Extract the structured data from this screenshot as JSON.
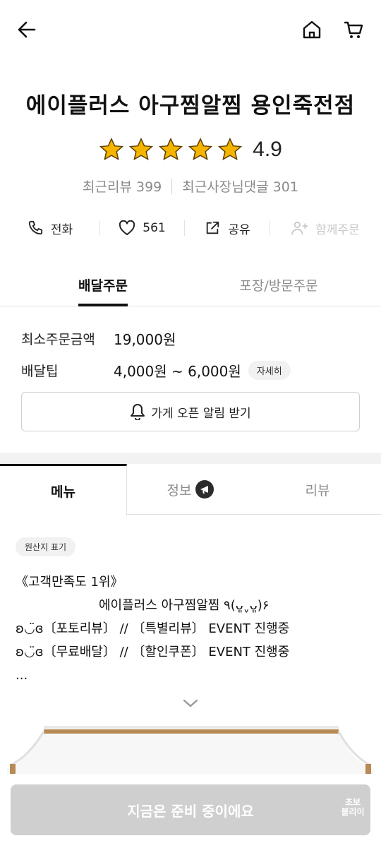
{
  "store": {
    "name": "에이플러스 아구찜알찜 용인죽전점",
    "rating": "4.9",
    "rating_stars": 5
  },
  "reviews": {
    "recent_reviews": "최근리뷰 399",
    "owner_replies": "최근사장님댓글 301"
  },
  "actions": {
    "call": "전화",
    "likes": "561",
    "share": "공유",
    "group_order": "함께주문"
  },
  "order_tabs": {
    "delivery": "배달주문",
    "pickup": "포장/방문주문"
  },
  "order_info": {
    "min_order_label": "최소주문금액",
    "min_order_value": "19,000원",
    "delivery_tip_label": "배달팁",
    "delivery_tip_value": "4,000원 ~ 6,000원",
    "detail_chip": "자세히"
  },
  "alarm_button": "가게 오픈 알림 받기",
  "menu_tabs": {
    "menu": "메뉴",
    "info": "정보",
    "review": "리뷰"
  },
  "origin_chip": "원산지 표기",
  "notice": {
    "line1": "《고객만족도 1위》",
    "line2": "에이플러스 아구찜알찜 ٩(ᴗ͈ˬᴗ͈)۶",
    "line3": "ʚ◡̈ɞ〔포토리뷰〕 // 〔특별리뷰〕 EVENT 진행중",
    "line4": "ʚ◡̈ɞ〔무료배달〕 // 〔할인쿠폰〕 EVENT 진행중",
    "line5": "..."
  },
  "cta": {
    "label": "지금은 준비 중이에요",
    "badge": "초보\n블리이"
  },
  "colors": {
    "star": "#f5b400",
    "active_tab": "#111111",
    "cta_disabled": "#cfcfcf"
  }
}
